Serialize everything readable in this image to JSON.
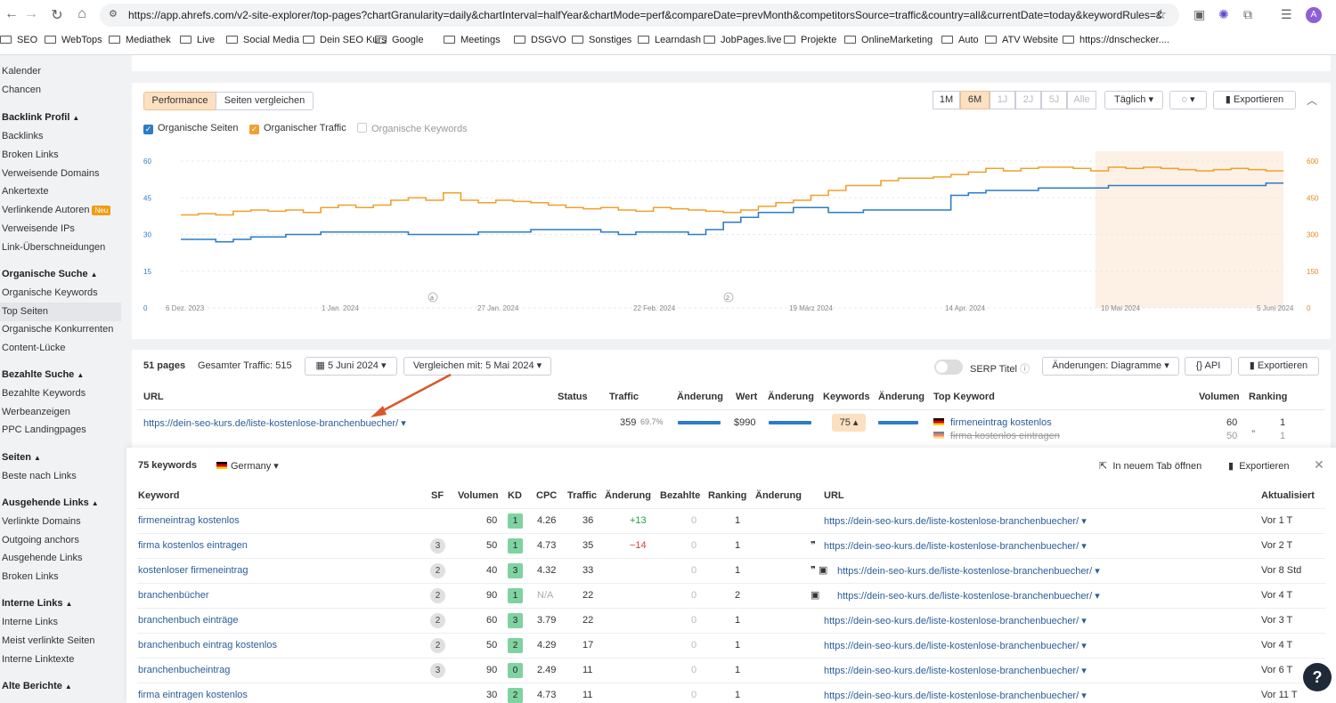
{
  "browser": {
    "url": "https://app.ahrefs.com/v2-site-explorer/top-pages?chartGranularity=daily&chartInterval=halfYear&chartMode=perf&compareDate=prevMonth&competitorsSource=traffic&country=all&currentDate=today&keywordRules=&limit=5...",
    "avatar": "A",
    "bookmarks": [
      "SEO",
      "WebTops",
      "Mediathek",
      "Live",
      "Social Media",
      "Dein SEO Kurs",
      "Google",
      "Meetings",
      "DSGVO",
      "Sonstiges",
      "Learndash",
      "JobPages.live",
      "Projekte",
      "OnlineMarketing",
      "Auto",
      "ATV Website",
      "https://dnschecker...."
    ]
  },
  "sidebar": {
    "top": [
      "Kalender",
      "Chancen"
    ],
    "groups": [
      {
        "title": "Backlink Profil",
        "items": [
          "Backlinks",
          "Broken Links",
          "Verweisende Domains",
          "Ankertexte",
          "Verlinkende Autoren",
          "Verweisende IPs",
          "Link-Überschneidungen"
        ]
      },
      {
        "title": "Organische Suche",
        "items": [
          "Organische Keywords",
          "Top Seiten",
          "Organische Konkurrenten",
          "Content-Lücke"
        ]
      },
      {
        "title": "Bezahlte Suche",
        "items": [
          "Bezahlte Keywords",
          "Werbeanzeigen",
          "PPC Landingpages"
        ]
      },
      {
        "title": "Seiten",
        "items": [
          "Beste nach Links"
        ]
      },
      {
        "title": "Ausgehende Links",
        "items": [
          "Verlinkte Domains",
          "Outgoing anchors",
          "Ausgehende Links",
          "Broken Links"
        ]
      },
      {
        "title": "Interne Links",
        "items": [
          "Interne Links",
          "Meist verlinkte Seiten",
          "Interne Linktexte"
        ]
      },
      {
        "title": "Alte Berichte",
        "items": []
      }
    ],
    "neu": "Neu"
  },
  "chart_controls": {
    "performance": "Performance",
    "compare": "Seiten vergleichen",
    "ranges": [
      "1M",
      "6M",
      "1J",
      "2J",
      "5J",
      "Alle"
    ],
    "active_range": "6M",
    "granularity": "Täglich",
    "export": "Exportieren",
    "legend": [
      {
        "label": "Organische Seiten",
        "checked": true,
        "color": "#2d7cc8"
      },
      {
        "label": "Organischer Traffic",
        "checked": true,
        "color": "#f0a02c"
      },
      {
        "label": "Organische Keywords",
        "checked": false,
        "color": "#cccccc"
      }
    ]
  },
  "chart_data": {
    "type": "line",
    "x_labels": [
      "6 Dez. 2023",
      "1 Jan. 2024",
      "27 Jan. 2024",
      "22 Feb. 2024",
      "19 März 2024",
      "14 Apr. 2024",
      "10 Mai 2024",
      "5 Juni 2024"
    ],
    "y_left": [
      0,
      15,
      30,
      45,
      60
    ],
    "y_right": [
      0,
      150,
      300,
      450,
      600
    ],
    "annotations": [
      "a",
      "2"
    ],
    "series": [
      {
        "name": "Organische Seiten",
        "axis": "left",
        "color": "#2d7cc8",
        "values": [
          28,
          28,
          27,
          28,
          29,
          29,
          30,
          30,
          31,
          31,
          31,
          31,
          31,
          30,
          30,
          30,
          30,
          31,
          31,
          31,
          32,
          32,
          32,
          32,
          31,
          30,
          31,
          31,
          31,
          30,
          32,
          35,
          37,
          39,
          39,
          41,
          41,
          39,
          39,
          40,
          40,
          40,
          40,
          40,
          46,
          47,
          48,
          48,
          48,
          49,
          49,
          49,
          49,
          50,
          50,
          50,
          50,
          50,
          50,
          50,
          50,
          50,
          51,
          51
        ]
      },
      {
        "name": "Organischer Traffic",
        "axis": "right",
        "color": "#f0a02c",
        "values": [
          380,
          385,
          380,
          395,
          400,
          395,
          400,
          390,
          410,
          420,
          410,
          420,
          440,
          450,
          440,
          470,
          440,
          430,
          440,
          435,
          430,
          420,
          410,
          405,
          410,
          400,
          395,
          410,
          405,
          400,
          395,
          390,
          400,
          415,
          430,
          440,
          460,
          480,
          500,
          500,
          520,
          530,
          530,
          535,
          545,
          555,
          570,
          560,
          570,
          575,
          575,
          570,
          560,
          575,
          570,
          575,
          570,
          565,
          560,
          565,
          570,
          565,
          560,
          560
        ]
      }
    ],
    "highlight": "10 Mai 2024 – 5 Juni 2024"
  },
  "table_bar": {
    "pages": "51 pages",
    "traffic": "Gesamter Traffic: 515",
    "date": "5 Juni 2024",
    "compare": "Vergleichen mit: 5 Mai 2024",
    "serp": "SERP Titel",
    "changes": "Änderungen: Diagramme",
    "api": "API",
    "export": "Exportieren"
  },
  "table": {
    "headers": [
      "URL",
      "Status",
      "Traffic",
      "Änderung",
      "Wert",
      "Änderung",
      "Keywords",
      "Änderung",
      "Top Keyword",
      "Volumen",
      "Ranking"
    ],
    "row": {
      "url": "https://dein-seo-kurs.de/liste-kostenlose-branchenbuecher/",
      "traffic": "359",
      "traffic_pct": "69.7%",
      "value": "$990",
      "keywords": "75",
      "top_keywords": [
        {
          "kw": "firmeneintrag kostenlos",
          "vol": "60",
          "rank": "1"
        },
        {
          "kw": "firma kostenlos eintragen",
          "vol": "50",
          "rank": "1"
        }
      ]
    }
  },
  "popup": {
    "count": "75 keywords",
    "country": "Germany",
    "new_tab": "In neuem Tab öffnen",
    "export": "Exportieren",
    "headers": [
      "Keyword",
      "SF",
      "Volumen",
      "KD",
      "CPC",
      "Traffic",
      "Änderung",
      "Bezahlte",
      "Ranking",
      "Änderung",
      "URL",
      "Aktualisiert"
    ],
    "rows": [
      {
        "keyword": "firmeneintrag kostenlos",
        "sf": "",
        "volume": "60",
        "kd": "1",
        "kd_color": "#7fd3a0",
        "cpc": "4.26",
        "traffic": "36",
        "change": "+13",
        "change_color": "#2a9a4a",
        "paid": "0",
        "ranking": "1",
        "icons": "",
        "url": "https://dein-seo-kurs.de/liste-kostenlose-branchenbuecher/",
        "updated": "Vor 1 T"
      },
      {
        "keyword": "firma kostenlos eintragen",
        "sf": "3",
        "volume": "50",
        "kd": "1",
        "kd_color": "#7fd3a0",
        "cpc": "4.73",
        "traffic": "35",
        "change": "−14",
        "change_color": "#d83b3b",
        "paid": "0",
        "ranking": "1",
        "icons": "❞",
        "url": "https://dein-seo-kurs.de/liste-kostenlose-branchenbuecher/",
        "updated": "Vor 2 T"
      },
      {
        "keyword": "kostenloser firmeneintrag",
        "sf": "2",
        "volume": "40",
        "kd": "3",
        "kd_color": "#7fd3a0",
        "cpc": "4.32",
        "traffic": "33",
        "change": "",
        "change_color": "#333",
        "paid": "0",
        "ranking": "1",
        "icons": "❞ ▣",
        "url": "https://dein-seo-kurs.de/liste-kostenlose-branchenbuecher/",
        "updated": "Vor 8 Std"
      },
      {
        "keyword": "branchenbücher",
        "sf": "2",
        "volume": "90",
        "kd": "1",
        "kd_color": "#7fd3a0",
        "cpc": "N/A",
        "traffic": "22",
        "change": "",
        "change_color": "#333",
        "paid": "0",
        "ranking": "2",
        "icons": "▣",
        "url": "https://dein-seo-kurs.de/liste-kostenlose-branchenbuecher/",
        "updated": "Vor 4 T"
      },
      {
        "keyword": "branchenbuch einträge",
        "sf": "2",
        "volume": "60",
        "kd": "3",
        "kd_color": "#7fd3a0",
        "cpc": "3.79",
        "traffic": "22",
        "change": "",
        "change_color": "#333",
        "paid": "0",
        "ranking": "1",
        "icons": "",
        "url": "https://dein-seo-kurs.de/liste-kostenlose-branchenbuecher/",
        "updated": "Vor 3 T"
      },
      {
        "keyword": "branchenbuch eintrag kostenlos",
        "sf": "2",
        "volume": "50",
        "kd": "2",
        "kd_color": "#7fd3a0",
        "cpc": "4.29",
        "traffic": "17",
        "change": "",
        "change_color": "#333",
        "paid": "0",
        "ranking": "1",
        "icons": "",
        "url": "https://dein-seo-kurs.de/liste-kostenlose-branchenbuecher/",
        "updated": "Vor 4 T"
      },
      {
        "keyword": "branchenbucheintrag",
        "sf": "3",
        "volume": "90",
        "kd": "0",
        "kd_color": "#7fd3a0",
        "cpc": "2.49",
        "traffic": "11",
        "change": "",
        "change_color": "#333",
        "paid": "0",
        "ranking": "1",
        "icons": "",
        "url": "https://dein-seo-kurs.de/liste-kostenlose-branchenbuecher/",
        "updated": "Vor 6 T"
      },
      {
        "keyword": "firma eintragen kostenlos",
        "sf": "",
        "volume": "30",
        "kd": "2",
        "kd_color": "#7fd3a0",
        "cpc": "4.73",
        "traffic": "11",
        "change": "",
        "change_color": "#333",
        "paid": "0",
        "ranking": "1",
        "icons": "",
        "url": "https://dein-seo-kurs.de/liste-kostenlose-branchenbuecher/",
        "updated": "Vor 11 T"
      }
    ]
  },
  "help": "?"
}
